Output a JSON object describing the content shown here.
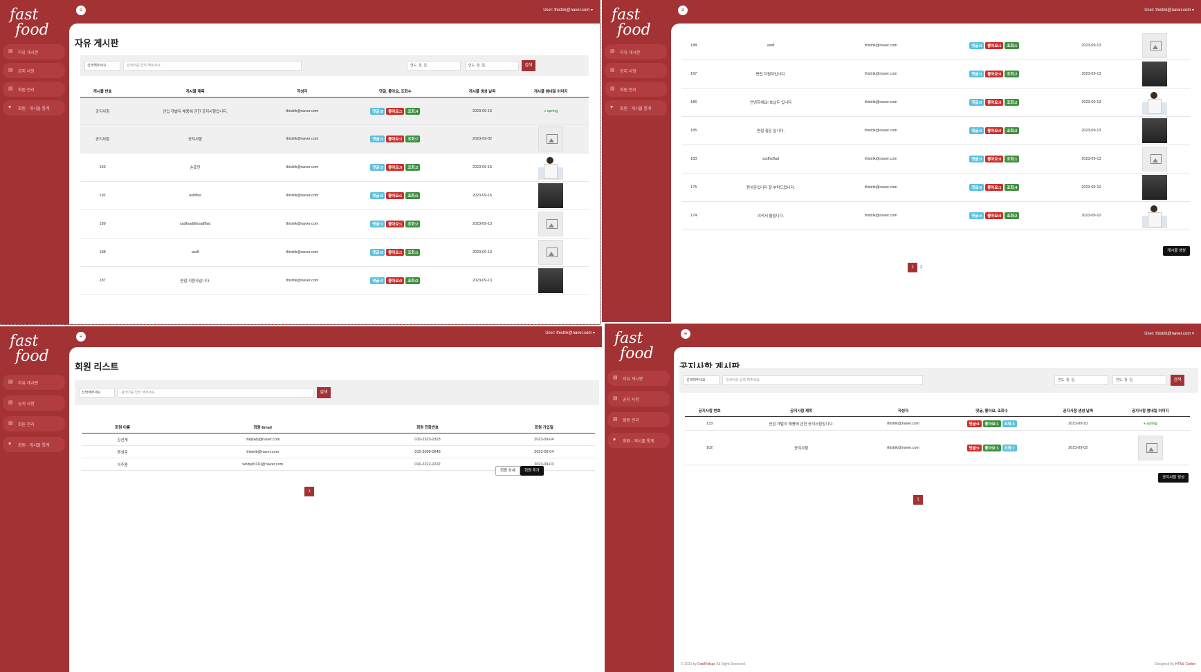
{
  "app": {
    "logo_text": "fast food",
    "user_label": "User: thistrik@naver.com ▾",
    "menu_icon": "hamburger-icon"
  },
  "sidebar": {
    "items": [
      {
        "label": "자유 게시판",
        "icon": "board-icon"
      },
      {
        "label": "공지 사항",
        "icon": "notice-icon"
      },
      {
        "label": "회원 관리",
        "icon": "users-icon"
      },
      {
        "label": "회원 · 게시물 통계",
        "icon": "heart-icon"
      }
    ]
  },
  "free_board": {
    "title": "자유 게시판",
    "select_placeholder": "선택해주세요",
    "search_placeholder": "검색어를 입력 해주세요.",
    "date_placeholder": "연도. 월. 일.",
    "search_button": "검색",
    "columns": [
      "게시물 번호",
      "게시물 제목",
      "작성자",
      "댓글, 좋아요, 조회수",
      "게시물 생성 날짜",
      "게시물 썸네일 이미지"
    ],
    "rows": [
      {
        "no": "공지사항",
        "title": "신입 개발자 채용에 관한 공지사항입니다.",
        "author": "thistrik@naver.com",
        "cmt": "댓글:8",
        "like": "좋아요:1",
        "view": "조회:4",
        "date": "2023-09-10",
        "thumb": "logo",
        "pinned": true
      },
      {
        "no": "공지사항",
        "title": "공지사항",
        "author": "thistrik@naver.com",
        "cmt": "댓글:0",
        "like": "좋아요:3",
        "view": "조회:7",
        "date": "2023-09-02",
        "thumb": "placeholder",
        "pinned": true
      },
      {
        "no": "193",
        "title": "손흥민",
        "author": "thistrik@naver.com",
        "cmt": "댓글:0",
        "like": "좋아요:0",
        "view": "조회:2",
        "date": "2023-09-15",
        "thumb": "player"
      },
      {
        "no": "192",
        "title": "asfdfsa",
        "author": "thistrik@naver.com",
        "cmt": "댓글:0",
        "like": "좋아요:1",
        "view": "조회:1",
        "date": "2023-09-15",
        "thumb": "photo"
      },
      {
        "no": "189",
        "title": "sadfsaddfssadffad",
        "author": "thistrik@naver.com",
        "cmt": "댓글:0",
        "like": "좋아요:1",
        "view": "조회:2",
        "date": "2023-09-13",
        "thumb": "placeholder"
      },
      {
        "no": "188",
        "title": "asdf",
        "author": "thistrik@naver.com",
        "cmt": "댓글:0",
        "like": "좋아요:1",
        "view": "조회:1",
        "date": "2023-09-13",
        "thumb": "placeholder"
      },
      {
        "no": "187",
        "title": "면접 지원자입니다.",
        "author": "thistrik@naver.com",
        "cmt": "댓글:0",
        "like": "좋아요:0",
        "view": "조회:2",
        "date": "2023-09-13",
        "thumb": "photo"
      }
    ]
  },
  "free_board_bottom": {
    "rows": [
      {
        "no": "188",
        "title": "asdf",
        "author": "thistrik@naver.com",
        "cmt": "댓글:0",
        "like": "좋아요:1",
        "view": "조회:1",
        "date": "2023-09-13",
        "thumb": "placeholder"
      },
      {
        "no": "187",
        "title": "면접 지원자입니다.",
        "author": "thistrik@naver.com",
        "cmt": "댓글:0",
        "like": "좋아요:0",
        "view": "조회:2",
        "date": "2023-09-13",
        "thumb": "photo"
      },
      {
        "no": "186",
        "title": "안녕하세요! 호날두 입니다",
        "author": "thistrik@naver.com",
        "cmt": "댓글:0",
        "like": "좋아요:0",
        "view": "조회:2",
        "date": "2023-09-13",
        "thumb": "player"
      },
      {
        "no": "185",
        "title": "면접 질문 입니다.",
        "author": "thistrik@naver.com",
        "cmt": "댓글:0",
        "like": "좋아요:0",
        "view": "조회:2",
        "date": "2023-09-13",
        "thumb": "photo"
      },
      {
        "no": "183",
        "title": "asdfsdfad",
        "author": "thistrik@naver.com",
        "cmt": "댓글:0",
        "like": "좋아요:0",
        "view": "조회:1",
        "date": "2023-09-13",
        "thumb": "placeholder"
      },
      {
        "no": "175",
        "title": "원성준입니다 잘 부탁드립니다.",
        "author": "thistrik@naver.com",
        "cmt": "댓글:6",
        "like": "좋아요:1",
        "view": "조회:4",
        "date": "2023-09-10",
        "thumb": "photo"
      },
      {
        "no": "174",
        "title": "이적서 올립니다.",
        "author": "thistrik@naver.com",
        "cmt": "댓글:0",
        "like": "좋아요:0",
        "view": "조회:2",
        "date": "2023-09-10",
        "thumb": "player"
      }
    ],
    "pages": [
      "1",
      "2"
    ],
    "create_button": "게시물 생성"
  },
  "members": {
    "title": "회원 리스트",
    "select_placeholder": "선택해주세요",
    "search_placeholder": "검색어를 입력 해주세요.",
    "search_button": "검색",
    "columns": [
      "회원 이름",
      "회원 Email",
      "회원 전화번호",
      "회원 가입일"
    ],
    "rows": [
      {
        "name": "김선재",
        "email": "rlatjswp@naver.com",
        "phone": "010-2323-2323",
        "date": "2023-09-04"
      },
      {
        "name": "원성준",
        "email": "thistrik@naver.com",
        "phone": "010-3099-0648",
        "date": "2023-09-04"
      },
      {
        "name": "이주용",
        "email": "wndyd0110@naver.com",
        "phone": "010-2222-2222",
        "date": "2023-09-03"
      }
    ],
    "detail_button": "회원 상세",
    "add_button": "회원 추가",
    "pages": [
      "1"
    ]
  },
  "notice_board": {
    "title": "공지사항 게시판",
    "select_placeholder": "선택해주세요",
    "search_placeholder": "검색어를 입력 해주세요.",
    "date_placeholder": "연도. 월. 일.",
    "search_button": "검색",
    "columns": [
      "공지사항 번호",
      "공지사항 제목",
      "작성자",
      "댓글, 좋아요, 조회수",
      "공지사항 생성 날짜",
      "공지사항 썸네일 이미지"
    ],
    "rows": [
      {
        "no": "133",
        "title": "신입 개발자 채용에 관한 공지사항입니다.",
        "author": "thistrik@naver.com",
        "cmt": "댓글:8",
        "like": "좋아요:1",
        "view": "조회:4",
        "date": "2023-09-10",
        "thumb": "logo"
      },
      {
        "no": "102",
        "title": "공지사항",
        "author": "thistrik@naver.com",
        "cmt": "댓글:0",
        "like": "좋아요:3",
        "view": "조회:7",
        "date": "2023-09-02",
        "thumb": "placeholder"
      }
    ],
    "create_button": "공지사항 생성",
    "pages": [
      "1"
    ],
    "footer_left_prefix": "© 2023 by",
    "footer_left_brand": "FastPickup",
    "footer_left_suffix": "All Right Reserved.",
    "footer_right_prefix": "Designed By",
    "footer_right_brand": "HTML Codex"
  },
  "colors": {
    "brand": "#a33234",
    "comment_badge": "#5bc0de",
    "like_badge": "#c9302c",
    "view_badge": "#3f8f3f"
  }
}
